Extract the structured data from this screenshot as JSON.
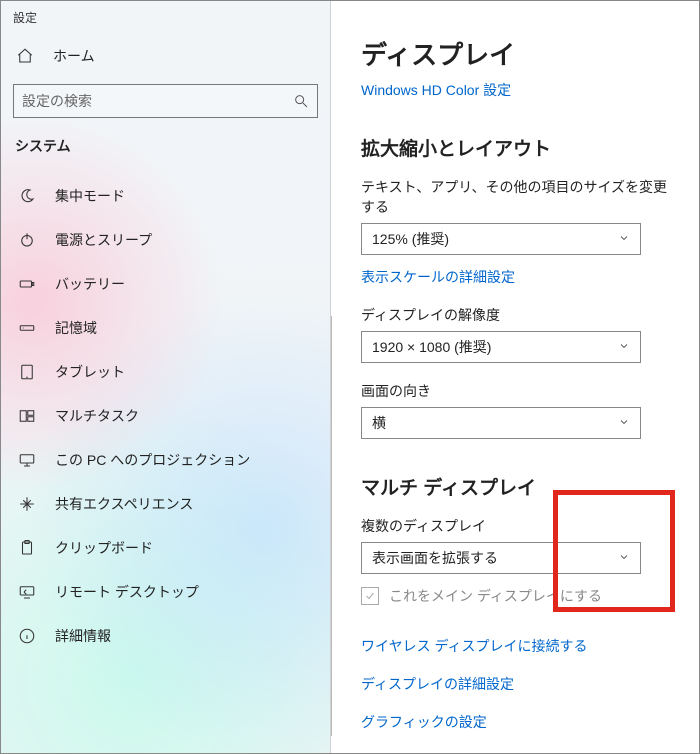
{
  "app_title": "設定",
  "sidebar": {
    "home_label": "ホーム",
    "search_placeholder": "設定の検索",
    "category_label": "システム",
    "items": [
      {
        "icon": "focus",
        "label": "集中モード"
      },
      {
        "icon": "power",
        "label": "電源とスリープ"
      },
      {
        "icon": "battery",
        "label": "バッテリー"
      },
      {
        "icon": "storage",
        "label": "記憶域"
      },
      {
        "icon": "tablet",
        "label": "タブレット"
      },
      {
        "icon": "multitask",
        "label": "マルチタスク"
      },
      {
        "icon": "project",
        "label": "この PC へのプロジェクション"
      },
      {
        "icon": "shared",
        "label": "共有エクスペリエンス"
      },
      {
        "icon": "clipboard",
        "label": "クリップボード"
      },
      {
        "icon": "remote",
        "label": "リモート デスクトップ"
      },
      {
        "icon": "info",
        "label": "詳細情報"
      }
    ]
  },
  "main": {
    "title": "ディスプレイ",
    "hd_color_link": "Windows HD Color 設定",
    "scale_section": "拡大縮小とレイアウト",
    "scale_label": "テキスト、アプリ、その他の項目のサイズを変更する",
    "scale_value": "125% (推奨)",
    "scale_link": "表示スケールの詳細設定",
    "resolution_label": "ディスプレイの解像度",
    "resolution_value": "1920 × 1080 (推奨)",
    "orientation_label": "画面の向き",
    "orientation_value": "横",
    "multi_section": "マルチ ディスプレイ",
    "multi_label": "複数のディスプレイ",
    "multi_value": "表示画面を拡張する",
    "main_display_cb": "これをメイン ディスプレイにする",
    "wireless_link": "ワイヤレス ディスプレイに接続する",
    "advanced_link": "ディスプレイの詳細設定",
    "graphics_link": "グラフィックの設定"
  }
}
